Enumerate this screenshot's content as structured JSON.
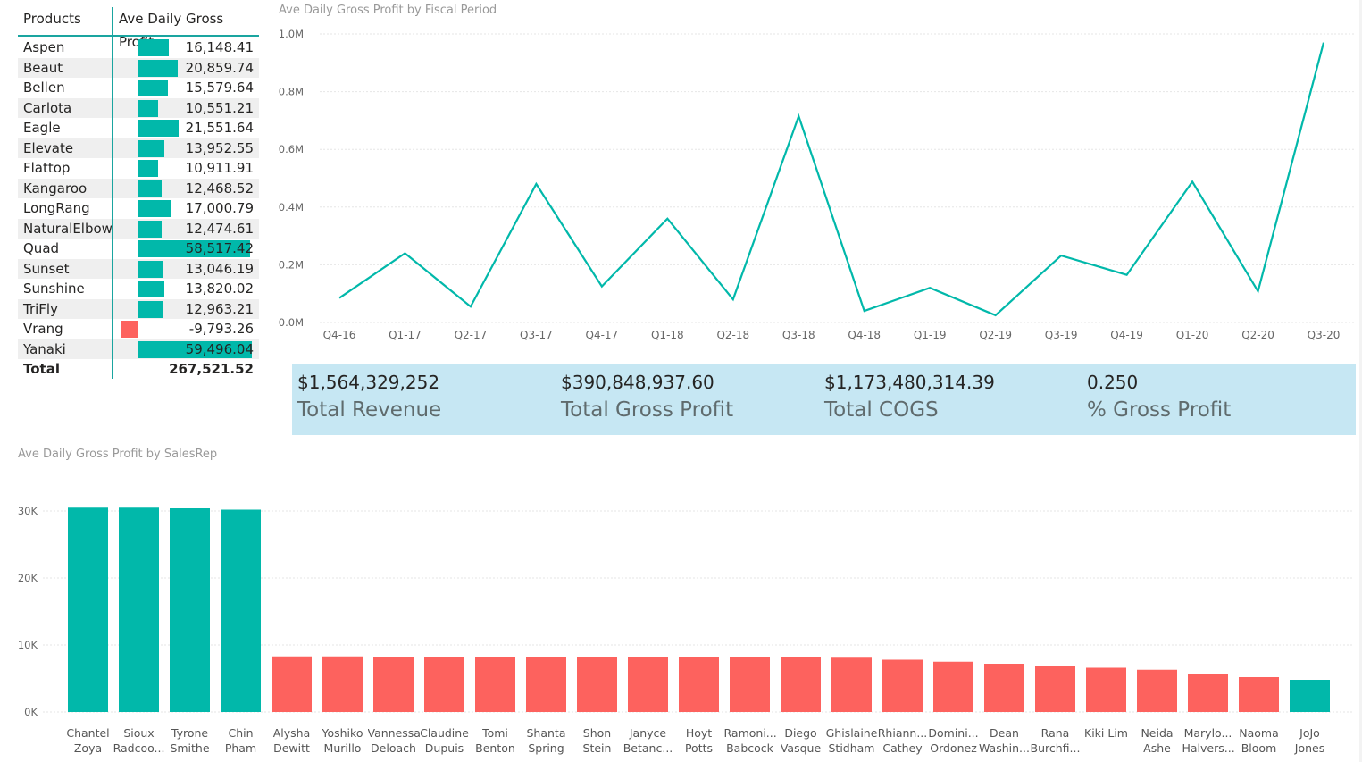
{
  "matrix": {
    "col_products": "Products",
    "col_measure": "Ave Daily Gross Profit",
    "rows": [
      {
        "name": "Aspen",
        "value": "16,148.41",
        "num": 16148.41
      },
      {
        "name": "Beaut",
        "value": "20,859.74",
        "num": 20859.74
      },
      {
        "name": "Bellen",
        "value": "15,579.64",
        "num": 15579.64
      },
      {
        "name": "Carlota",
        "value": "10,551.21",
        "num": 10551.21
      },
      {
        "name": "Eagle",
        "value": "21,551.64",
        "num": 21551.64
      },
      {
        "name": "Elevate",
        "value": "13,952.55",
        "num": 13952.55
      },
      {
        "name": "Flattop",
        "value": "10,911.91",
        "num": 10911.91
      },
      {
        "name": "Kangaroo",
        "value": "12,468.52",
        "num": 12468.52
      },
      {
        "name": "LongRang",
        "value": "17,000.79",
        "num": 17000.79
      },
      {
        "name": "NaturalElbow",
        "value": "12,474.61",
        "num": 12474.61
      },
      {
        "name": "Quad",
        "value": "58,517.42",
        "num": 58517.42
      },
      {
        "name": "Sunset",
        "value": "13,046.19",
        "num": 13046.19
      },
      {
        "name": "Sunshine",
        "value": "13,820.02",
        "num": 13820.02
      },
      {
        "name": "TriFly",
        "value": "12,963.21",
        "num": 12963.21
      },
      {
        "name": "Vrang",
        "value": "-9,793.26",
        "num": -9793.26
      },
      {
        "name": "Yanaki",
        "value": "59,496.04",
        "num": 59496.04
      }
    ],
    "total_label": "Total",
    "total_value": "267,521.52",
    "pos_color": "#01b8aa",
    "neg_color": "#fd625e"
  },
  "line_visual": {
    "title": "Ave Daily Gross Profit by Fiscal Period"
  },
  "bar_visual": {
    "title": "Ave Daily Gross Profit by SalesRep"
  },
  "cards": [
    {
      "value": "$1,564,329,252",
      "label": "Total Revenue"
    },
    {
      "value": "$390,848,937.60",
      "label": "Total Gross Profit"
    },
    {
      "value": "$1,173,480,314.39",
      "label": "Total COGS"
    },
    {
      "value": "0.250",
      "label": "% Gross Profit"
    }
  ],
  "chart_data": [
    {
      "type": "line",
      "title": "Ave Daily Gross Profit by Fiscal Period",
      "x": [
        "Q4-16",
        "Q1-17",
        "Q2-17",
        "Q3-17",
        "Q4-17",
        "Q1-18",
        "Q2-18",
        "Q3-18",
        "Q4-18",
        "Q1-19",
        "Q2-19",
        "Q3-19",
        "Q4-19",
        "Q1-20",
        "Q2-20",
        "Q3-20"
      ],
      "y": [
        85000,
        240000,
        55000,
        480000,
        125000,
        360000,
        80000,
        715000,
        40000,
        120000,
        25000,
        232000,
        165000,
        488000,
        108000,
        970000
      ],
      "y_ticks": [
        "0.0M",
        "0.2M",
        "0.4M",
        "0.6M",
        "0.8M",
        "1.0M"
      ],
      "ylim": [
        0,
        1000000
      ],
      "color": "#01b8aa",
      "grid": true
    },
    {
      "type": "bar",
      "title": "Ave Daily Gross Profit by SalesRep",
      "categories": [
        [
          "Chantel",
          "Zoya"
        ],
        [
          "Sioux",
          "Radcoo..."
        ],
        [
          "Tyrone",
          "Smithe"
        ],
        [
          "Chin",
          "Pham"
        ],
        [
          "Alysha",
          "Dewitt"
        ],
        [
          "Yoshiko",
          "Murillo"
        ],
        [
          "Vannessa",
          "Deloach"
        ],
        [
          "Claudine",
          "Dupuis"
        ],
        [
          "Tomi",
          "Benton"
        ],
        [
          "Shanta",
          "Spring"
        ],
        [
          "Shon",
          "Stein"
        ],
        [
          "Janyce",
          "Betanc..."
        ],
        [
          "Hoyt",
          "Potts"
        ],
        [
          "Ramoni...",
          "Babcock"
        ],
        [
          "Diego",
          "Vasque"
        ],
        [
          "Ghislaine",
          "Stidham"
        ],
        [
          "Rhiann...",
          "Cathey"
        ],
        [
          "Domini...",
          "Ordonez"
        ],
        [
          "Dean",
          "Washin..."
        ],
        [
          "Rana",
          "Burchfi..."
        ],
        [
          "Kiki Lim",
          ""
        ],
        [
          "Neida",
          "Ashe"
        ],
        [
          "Marylo...",
          "Halvers..."
        ],
        [
          "Naoma",
          "Bloom"
        ],
        [
          "JoJo",
          "Jones"
        ]
      ],
      "values": [
        30500,
        30500,
        30400,
        30200,
        8300,
        8300,
        8250,
        8250,
        8250,
        8200,
        8200,
        8150,
        8150,
        8150,
        8150,
        8100,
        7800,
        7500,
        7200,
        6900,
        6600,
        6300,
        5700,
        5200,
        4800
      ],
      "colors": [
        "#01b8aa",
        "#01b8aa",
        "#01b8aa",
        "#01b8aa",
        "#fd625e",
        "#fd625e",
        "#fd625e",
        "#fd625e",
        "#fd625e",
        "#fd625e",
        "#fd625e",
        "#fd625e",
        "#fd625e",
        "#fd625e",
        "#fd625e",
        "#fd625e",
        "#fd625e",
        "#fd625e",
        "#fd625e",
        "#fd625e",
        "#fd625e",
        "#fd625e",
        "#fd625e",
        "#fd625e",
        "#01b8aa"
      ],
      "y_ticks": [
        "0K",
        "10K",
        "20K",
        "30K"
      ],
      "ylim": [
        0,
        32000
      ],
      "grid": true
    }
  ]
}
